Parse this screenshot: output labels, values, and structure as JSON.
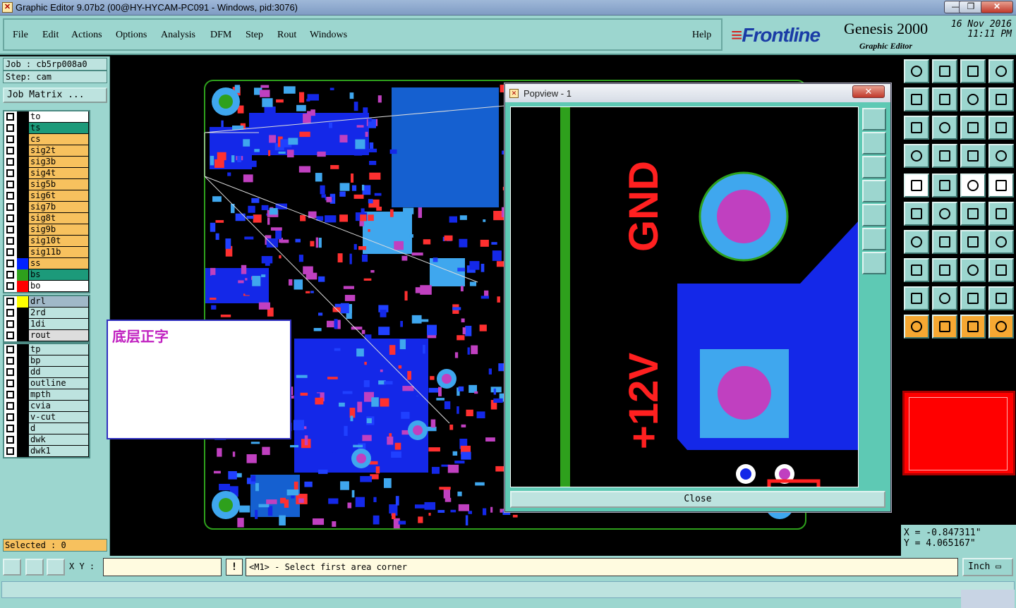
{
  "window": {
    "title": "Graphic Editor 9.07b2 (00@HY-HYCAM-PC091 - Windows, pid:3076)"
  },
  "menu": {
    "items": [
      "File",
      "Edit",
      "Actions",
      "Options",
      "Analysis",
      "DFM",
      "Step",
      "Rout",
      "Windows"
    ],
    "help": "Help"
  },
  "brand": {
    "logo": "Frontline",
    "product": "Genesis 2000",
    "subtitle": "Graphic Editor",
    "date": "16 Nov 2016",
    "time": "11:11 PM"
  },
  "job": {
    "job_label": "Job  : cb5rp008a0",
    "step_label": "Step: cam",
    "matrix_button": "Job Matrix ..."
  },
  "layers": {
    "group1": [
      {
        "name": "to",
        "color": "#000000",
        "bg": "#ffffff"
      },
      {
        "name": "ts",
        "color": "#000000",
        "bg": "#1c9a7a"
      },
      {
        "name": "cs",
        "color": "#000000",
        "bg": "#f7c15e"
      },
      {
        "name": "sig2t",
        "color": "#000000",
        "bg": "#f7c15e"
      },
      {
        "name": "sig3b",
        "color": "#000000",
        "bg": "#f7c15e"
      },
      {
        "name": "sig4t",
        "color": "#000000",
        "bg": "#f7c15e"
      },
      {
        "name": "sig5b",
        "color": "#000000",
        "bg": "#f7c15e"
      },
      {
        "name": "sig6t",
        "color": "#000000",
        "bg": "#f7c15e"
      },
      {
        "name": "sig7b",
        "color": "#000000",
        "bg": "#f7c15e"
      },
      {
        "name": "sig8t",
        "color": "#000000",
        "bg": "#f7c15e"
      },
      {
        "name": "sig9b",
        "color": "#000000",
        "bg": "#f7c15e"
      },
      {
        "name": "sig10t",
        "color": "#000000",
        "bg": "#f7c15e"
      },
      {
        "name": "sig11b",
        "color": "#000000",
        "bg": "#f7c15e"
      },
      {
        "name": "ss",
        "color": "#0022ff",
        "bg": "#f7c15e"
      },
      {
        "name": "bs",
        "color": "#2ea01c",
        "bg": "#1c9a7a"
      },
      {
        "name": "bo",
        "color": "#ff0000",
        "bg": "#ffffff"
      }
    ],
    "group2": [
      {
        "name": "drl",
        "color": "#ffff00",
        "bg": "#a0b8c8"
      },
      {
        "name": "2rd",
        "color": "#000000",
        "bg": "#bde3df"
      },
      {
        "name": "1di",
        "color": "#000000",
        "bg": "#bde3df"
      },
      {
        "name": "rout",
        "color": "#000000",
        "bg": "#dddddd"
      }
    ],
    "group3": [
      {
        "name": "tp",
        "color": "#000000",
        "bg": "#bde3df"
      },
      {
        "name": "bp",
        "color": "#000000",
        "bg": "#bde3df"
      },
      {
        "name": "dd",
        "color": "#000000",
        "bg": "#bde3df"
      },
      {
        "name": "outline",
        "color": "#000000",
        "bg": "#bde3df"
      },
      {
        "name": "mpth",
        "color": "#000000",
        "bg": "#bde3df"
      },
      {
        "name": "cvia",
        "color": "#000000",
        "bg": "#bde3df"
      },
      {
        "name": "v-cut",
        "color": "#000000",
        "bg": "#bde3df"
      },
      {
        "name": "d",
        "color": "#000000",
        "bg": "#bde3df"
      },
      {
        "name": "dwk",
        "color": "#000000",
        "bg": "#bde3df"
      },
      {
        "name": "dwk1",
        "color": "#000000",
        "bg": "#bde3df"
      }
    ]
  },
  "selected": "Selected : 0",
  "note": {
    "text": "底层正字"
  },
  "popview": {
    "title": "Popview - 1",
    "close_x": "✕",
    "close_button": "Close",
    "labels": {
      "gnd": "GND",
      "v12": "+12V"
    }
  },
  "coords": {
    "x": "X = -0.847311\"",
    "y": "Y = 4.065167\""
  },
  "status": {
    "xy_label": "X Y :",
    "xy_value": "",
    "excl": "!",
    "prompt": "<M1> - Select first area corner",
    "unit": "Inch"
  },
  "window_buttons": {
    "min": "—",
    "max": "❐",
    "close": "✕"
  }
}
